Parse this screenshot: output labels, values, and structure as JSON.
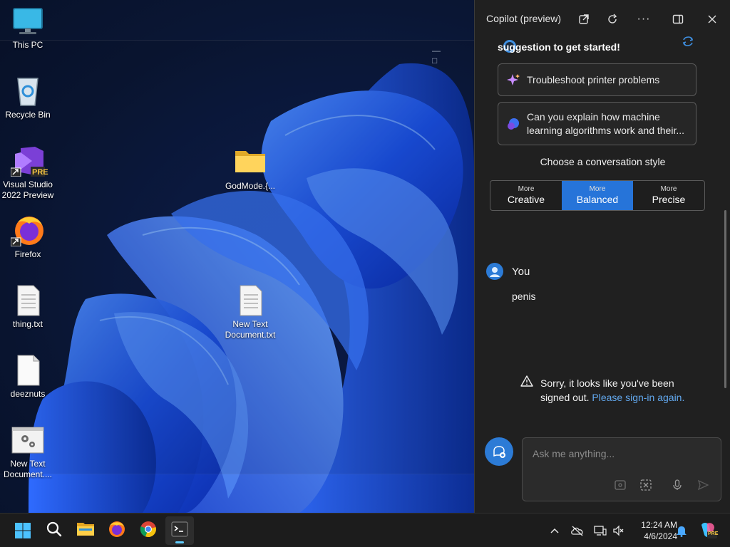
{
  "desktop": {
    "icons": [
      {
        "label": "This PC"
      },
      {
        "label": "Recycle Bin"
      },
      {
        "label": "Visual Studio 2022 Preview",
        "badge": "PRE"
      },
      {
        "label": "Firefox"
      },
      {
        "label": "thing.txt"
      },
      {
        "label": "deeznuts"
      },
      {
        "label": "New Text Document...."
      },
      {
        "label": "GodMode.{..."
      },
      {
        "label": "New Text Document.txt"
      }
    ]
  },
  "copilot": {
    "title": "Copilot (preview)",
    "intro": "suggestion to get started!",
    "suggestions": [
      {
        "text": "Troubleshoot printer problems"
      },
      {
        "text": "Can you explain how machine learning algorithms work and their..."
      }
    ],
    "style_heading": "Choose a conversation style",
    "styles": [
      {
        "more": "More",
        "name": "Creative"
      },
      {
        "more": "More",
        "name": "Balanced"
      },
      {
        "more": "More",
        "name": "Precise"
      }
    ],
    "active_style": "Balanced",
    "user_label": "You",
    "user_message": "penis",
    "warning_text": "Sorry, it looks like you've been signed out.",
    "warning_link": "Please sign-in again.",
    "ask_placeholder": "Ask me anything..."
  },
  "taskbar": {
    "apps": [
      "start",
      "search",
      "file-explorer",
      "firefox",
      "chrome",
      "terminal"
    ],
    "active_app": "terminal",
    "time": "12:24 AM",
    "date": "4/6/2024",
    "copilot_badge": "PRE"
  },
  "colors": {
    "accent": "#2674d9",
    "link": "#62a8ee",
    "panel_bg": "#202020",
    "taskbar_bg": "#1c1c1c"
  }
}
